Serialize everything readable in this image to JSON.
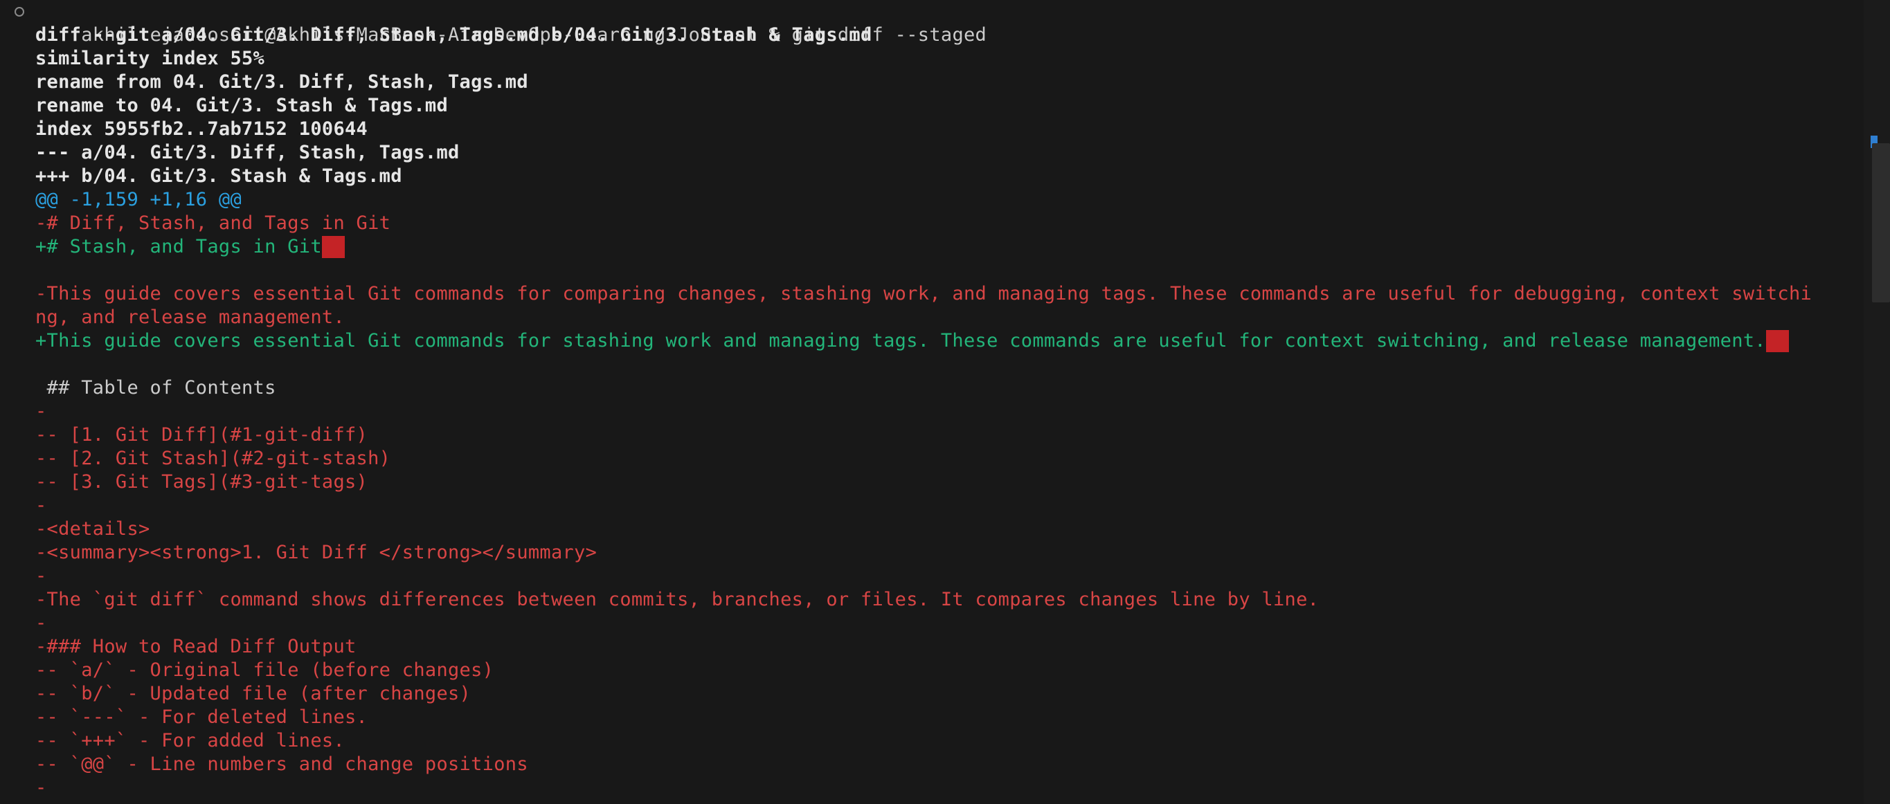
{
  "terminal": {
    "prompt": "akhiltejadoosari@Akhils-MacBook-Air DevOps-Learning-Journal % git diff --staged",
    "lines": [
      {
        "type": "meta",
        "text": "diff --git a/04. Git/3. Diff, Stash, Tags.md b/04. Git/3. Stash & Tags.md"
      },
      {
        "type": "meta",
        "text": "similarity index 55%"
      },
      {
        "type": "meta",
        "text": "rename from 04. Git/3. Diff, Stash, Tags.md"
      },
      {
        "type": "meta",
        "text": "rename to 04. Git/3. Stash & Tags.md"
      },
      {
        "type": "meta",
        "text": "index 5955fb2..7ab7152 100644"
      },
      {
        "type": "meta",
        "text": "--- a/04. Git/3. Diff, Stash, Tags.md"
      },
      {
        "type": "meta",
        "text": "+++ b/04. Git/3. Stash & Tags.md"
      },
      {
        "type": "hunk",
        "text": "@@ -1,159 +1,16 @@"
      },
      {
        "type": "del",
        "text": "-# Diff, Stash, and Tags in Git"
      },
      {
        "type": "add",
        "text": "+# Stash, and Tags in Git",
        "trailing_ws": true
      },
      {
        "type": "blank",
        "text": ""
      },
      {
        "type": "del",
        "text": "-This guide covers essential Git commands for comparing changes, stashing work, and managing tags. These commands are useful for debugging, context switchi"
      },
      {
        "type": "del",
        "text": "ng, and release management."
      },
      {
        "type": "add",
        "text": "+This guide covers essential Git commands for stashing work and managing tags. These commands are useful for context switching, and release management.",
        "trailing_ws": true
      },
      {
        "type": "blank",
        "text": ""
      },
      {
        "type": "ctx",
        "text": " ## Table of Contents"
      },
      {
        "type": "del",
        "text": "-"
      },
      {
        "type": "del",
        "text": "-- [1. Git Diff](#1-git-diff)"
      },
      {
        "type": "del",
        "text": "-- [2. Git Stash](#2-git-stash)"
      },
      {
        "type": "del",
        "text": "-- [3. Git Tags](#3-git-tags)"
      },
      {
        "type": "del",
        "text": "-"
      },
      {
        "type": "del",
        "text": "-<details>"
      },
      {
        "type": "del",
        "text": "-<summary><strong>1. Git Diff </strong></summary>"
      },
      {
        "type": "del",
        "text": "-"
      },
      {
        "type": "del",
        "text": "-The `git diff` command shows differences between commits, branches, or files. It compares changes line by line."
      },
      {
        "type": "del",
        "text": "-"
      },
      {
        "type": "del",
        "text": "-### How to Read Diff Output"
      },
      {
        "type": "del",
        "text": "-- `a/` - Original file (before changes)"
      },
      {
        "type": "del",
        "text": "-- `b/` - Updated file (after changes)"
      },
      {
        "type": "del",
        "text": "-- `---` - For deleted lines."
      },
      {
        "type": "del",
        "text": "-- `+++` - For added lines."
      },
      {
        "type": "del",
        "text": "-- `@@` - Line numbers and change positions"
      },
      {
        "type": "del",
        "text": "-"
      }
    ]
  },
  "colors": {
    "background": "#181818",
    "meta": "#e6e6e6",
    "hunk": "#2ba0e0",
    "deleted": "#d84545",
    "added": "#23b57a",
    "trailing_whitespace": "#c42326"
  },
  "icons": {
    "prompt_marker": "circle-outline-icon"
  }
}
